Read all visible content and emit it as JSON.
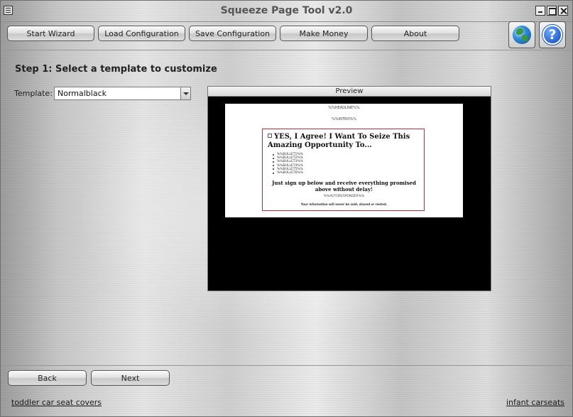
{
  "window": {
    "title": "Squeeze Page Tool v2.0"
  },
  "toolbar": {
    "buttons": [
      {
        "label": "Start Wizard"
      },
      {
        "label": "Load Configuration"
      },
      {
        "label": "Save Configuration"
      },
      {
        "label": "Make Money"
      },
      {
        "label": "About"
      }
    ],
    "icons": [
      "globe-icon",
      "help-icon"
    ],
    "help_glyph": "?"
  },
  "step": {
    "heading": "Step 1: Select a template to customize"
  },
  "template": {
    "label": "Template:",
    "selected": "Normalblack"
  },
  "preview": {
    "header": "Preview",
    "headline": "%%HEADLINE%%",
    "intro": "%%INTRO%%",
    "optin_title": "YES, I Agree! I Want To Seize This Amazing Opportunity To...",
    "bullets": [
      "%%BULLET1%%",
      "%%BULLET2%%",
      "%%BULLET3%%",
      "%%BULLET4%%",
      "%%BULLET5%%",
      "%%BULLET6%%"
    ],
    "signup_text": "Just sign up below and receive everything promised above without delay!",
    "autoresponder": "%%AUTORESPONDER%%",
    "privacy": "Your information will never be sold, shared or rented."
  },
  "navigation": {
    "back_label": "Back",
    "next_label": "Next"
  },
  "footer": {
    "left_link": "toddler car seat covers",
    "right_link": "infant carseats"
  }
}
